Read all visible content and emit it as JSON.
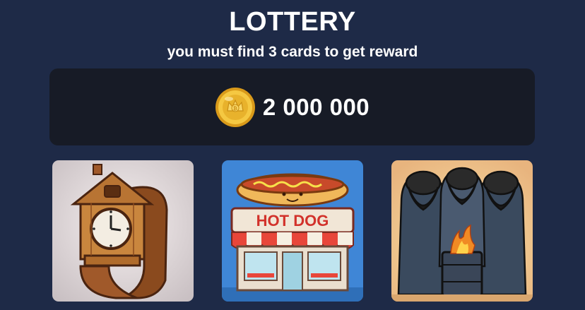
{
  "header": {
    "title": "LOTTERY",
    "subtitle": "you must find 3 cards to get reward"
  },
  "prize": {
    "icon": "gold-coin-icon",
    "amount": "2 000 000"
  },
  "cards": [
    {
      "name": "watch-cuckoo-clock-card",
      "sign_text": ""
    },
    {
      "name": "hot-dog-shop-card",
      "sign_text": "HOT DOG"
    },
    {
      "name": "people-by-fire-barrel-card",
      "sign_text": ""
    }
  ],
  "colors": {
    "background": "#1e2a47",
    "panel": "#171b26",
    "coin": "#f2c33a"
  }
}
